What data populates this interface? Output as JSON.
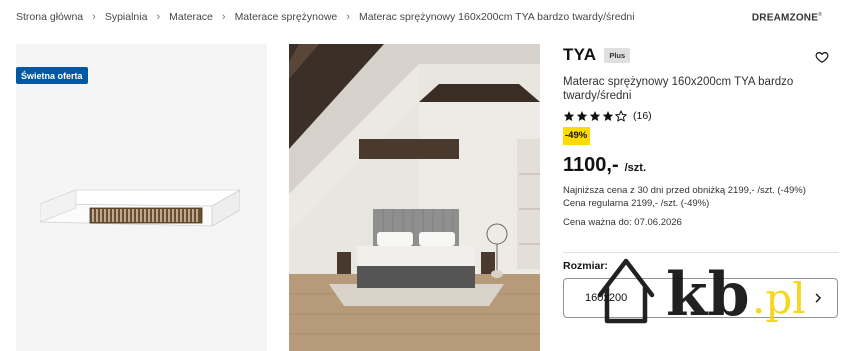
{
  "breadcrumb": {
    "items": [
      "Strona główna",
      "Sypialnia",
      "Materace",
      "Materace sprężynowe",
      "Materac sprężynowy 160x200cm TYA bardzo twardy/średni"
    ],
    "separator": "›"
  },
  "header": {
    "logo_text": "DREAMZONE",
    "logo_mark": "®"
  },
  "gallery": {
    "offer_badge": "Świetna oferta"
  },
  "product": {
    "brand": "TYA",
    "plus_label": "Plus",
    "name": "Materac sprężynowy 160x200cm TYA bardzo twardy/średni",
    "rating": {
      "stars": 4,
      "max": 5,
      "count_label": "(16)"
    },
    "discount_badge": "-49%",
    "price": "1100,-",
    "price_unit": "/szt.",
    "lowest_price_note": "Najniższa cena z 30 dni przed obniżką 2199,- /szt. (-49%)",
    "regular_price_note": "Cena regularna 2199,- /szt. (-49%)",
    "validity": "Cena ważna do: 07.06.2026",
    "size_label": "Rozmiar:",
    "size_value": "160x200"
  },
  "watermark": {
    "text": "kb",
    "suffix": ".pl"
  },
  "icons": {
    "wishlist": "heart-icon",
    "size_chevron": "chevron-right-icon",
    "rating": "star-icon"
  },
  "colors": {
    "badge_blue": "#0058a3",
    "discount_yellow": "#ffdb00",
    "watermark_yellow": "#f6d40e"
  }
}
